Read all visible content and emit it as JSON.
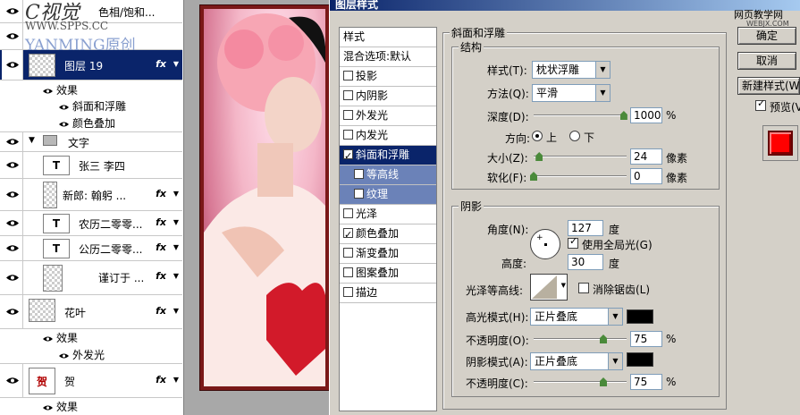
{
  "watermark_top": "C视觉",
  "watermark_site": "WWW.SPPS.CC",
  "watermark_yan": "YANMING原创",
  "layers": {
    "row0_label": "色相/饱和...",
    "layer19": "图层 19",
    "effects": "效果",
    "bevel": "斜面和浮雕",
    "color_overlay": "颜色叠加",
    "group_text": "文字",
    "zhangsan": "张三  李四",
    "groom": "新郎:     翰躬 ...",
    "lunar1": "农历二零零...",
    "solar1": "公历二零零...",
    "wedding": "谨订于   ...",
    "leaf": "花叶",
    "leaf_effects": "效果",
    "outer_glow": "外发光",
    "he": "贺",
    "he_effects": "效果",
    "fx": "fx"
  },
  "dialog": {
    "title": "图层样式",
    "styles": [
      "样式",
      "混合选项:默认",
      "投影",
      "内阴影",
      "外发光",
      "内发光",
      "斜面和浮雕",
      "等高线",
      "纹理",
      "光泽",
      "颜色叠加",
      "渐变叠加",
      "图案叠加",
      "描边"
    ],
    "bevel_group": "斜面和浮雕",
    "structure": "结构",
    "style_label": "样式(T):",
    "style_value": "枕状浮雕",
    "method_label": "方法(Q):",
    "method_value": "平滑",
    "depth_label": "深度(D):",
    "depth_value": "1000",
    "depth_unit": "%",
    "direction_label": "方向:",
    "dir_up": "上",
    "dir_down": "下",
    "size_label": "大小(Z):",
    "size_value": "24",
    "size_unit": "像素",
    "soften_label": "软化(F):",
    "soften_value": "0",
    "soften_unit": "像素",
    "shading": "阴影",
    "angle_label": "角度(N):",
    "angle_value": "127",
    "angle_unit": "度",
    "global_light": "使用全局光(G)",
    "altitude_label": "高度:",
    "altitude_value": "30",
    "altitude_unit": "度",
    "gloss_label": "光泽等高线:",
    "antialias": "消除锯齿(L)",
    "highlight_label": "高光模式(H):",
    "highlight_value": "正片叠底",
    "opacity1_label": "不透明度(O):",
    "opacity1_value": "75",
    "shadow_label": "阴影模式(A):",
    "shadow_value": "正片叠底",
    "opacity2_label": "不透明度(C):",
    "opacity2_value": "75",
    "pct": "%",
    "ok": "确定",
    "cancel": "取消",
    "new_style": "新建样式(W)...",
    "preview": "预览(V)",
    "watermark_web": "网页教学网",
    "watermark_web2": "WEBJX.COM"
  },
  "colors": {
    "preview_swatch": "#ff0000",
    "highlight": "#000000",
    "shadow": "#000000"
  },
  "sliders": {
    "depth_fraction": 0.97,
    "size_fraction": 0.06,
    "soften_fraction": 0.0,
    "opacity1_fraction": 0.75,
    "opacity2_fraction": 0.75
  }
}
